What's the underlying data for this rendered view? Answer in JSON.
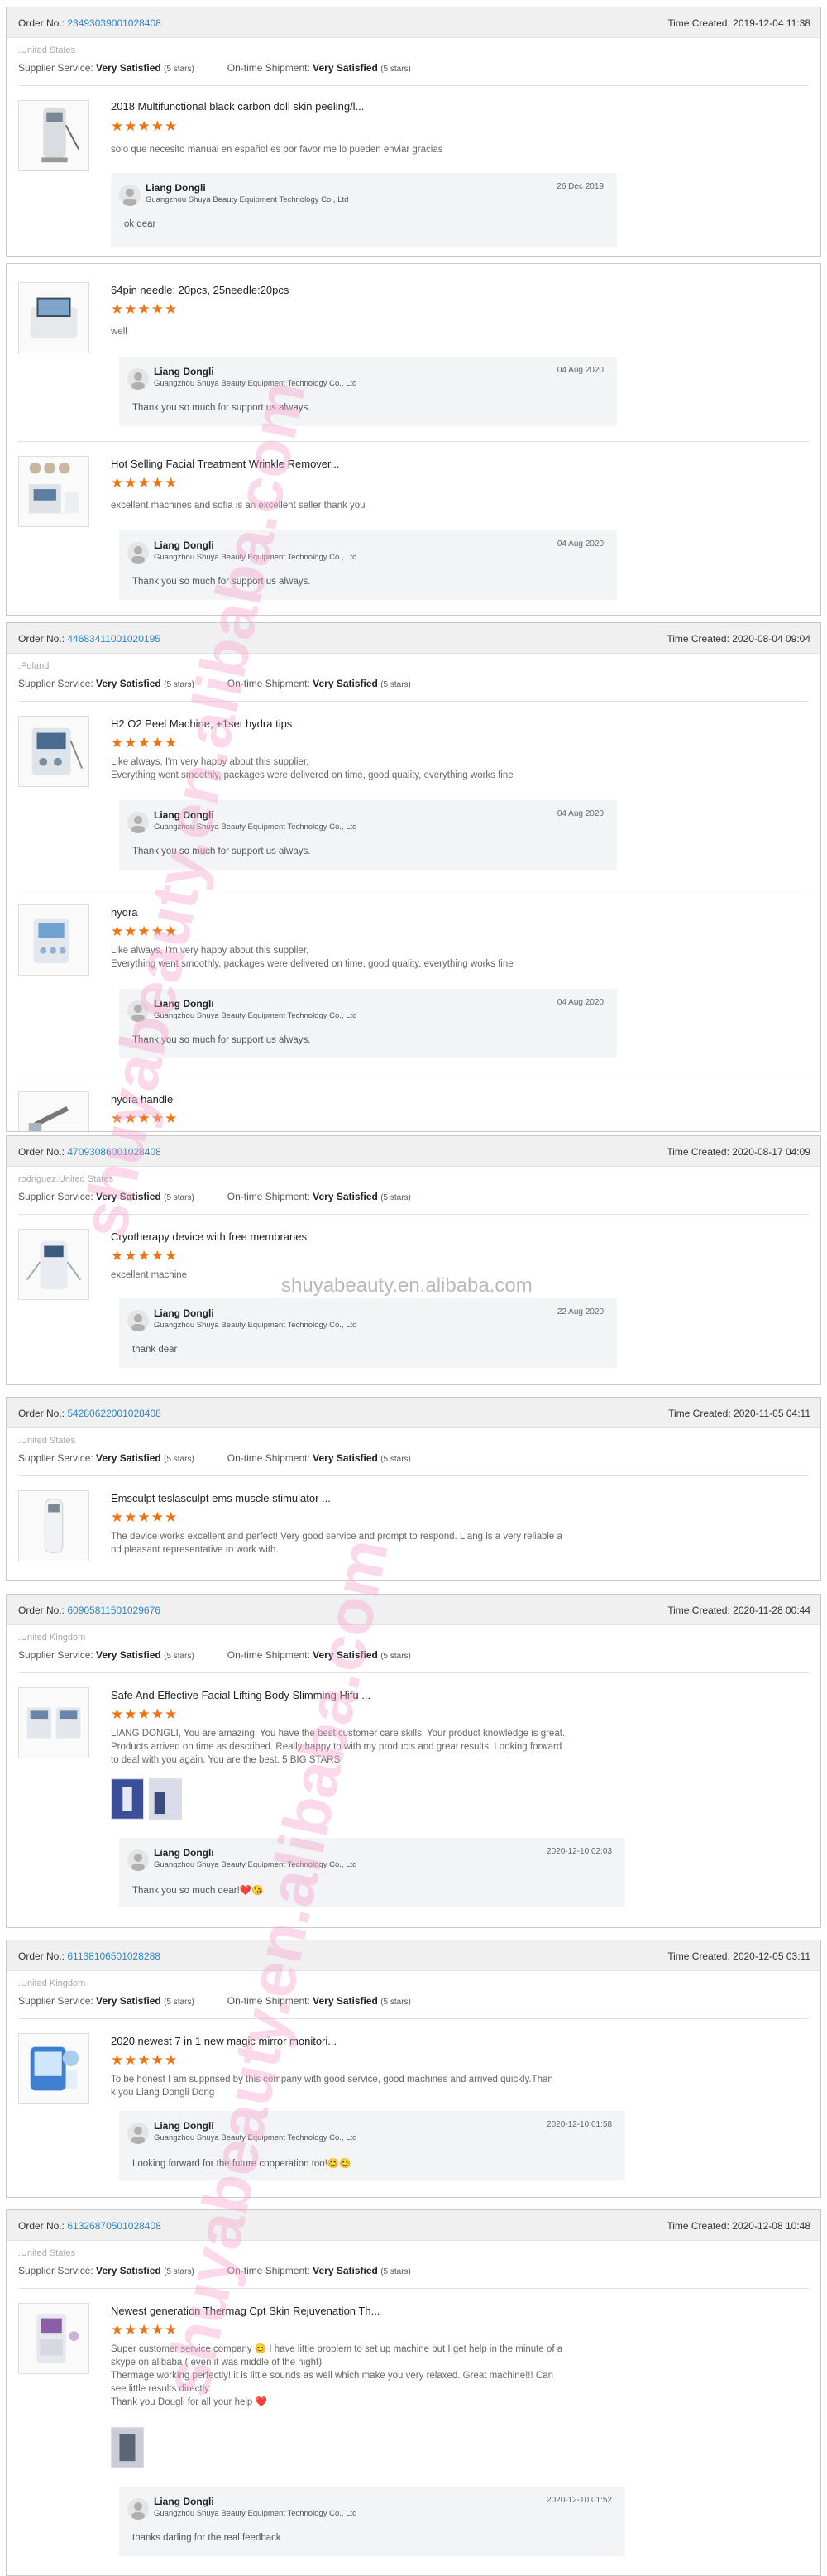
{
  "labels": {
    "order_no": "Order No.: ",
    "time_created": "Time Created: ",
    "supplier_service": "Supplier Service: ",
    "ontime_shipment": "On-time Shipment: ",
    "satisfied": "Very Satisfied",
    "five_stars": "(5 stars)",
    "replier": "Liang Dongli",
    "company": "Guangzhou Shuya Beauty Equipment Technology Co., Ltd"
  },
  "stars": "★★★★★",
  "watermark": "shuyabeauty.en.alibaba.com",
  "site_text": "shuyabeauty.en.alibaba.com",
  "orders": [
    {
      "order_no": "23493039001028408",
      "time": "2019-12-04 11:38",
      "buyer": ".United States",
      "items": [
        {
          "title": "2018 Multifunctional black carbon doll skin peeling/l...",
          "review": "solo que necesito manual en español es por favor me lo pueden enviar gracias",
          "reply_date": "26 Dec 2019",
          "reply": "ok dear"
        }
      ]
    },
    {
      "items": [
        {
          "title": "64pin needle: 20pcs, 25needle:20pcs",
          "review": "well",
          "reply_date": "04 Aug 2020",
          "reply": "Thank you so much for support us always."
        },
        {
          "title": "Hot Selling Facial Treatment Wrinkle Remover...",
          "review": "excellent machines and sofia is an excellent seller thank you",
          "reply_date": "04 Aug 2020",
          "reply": "Thank you so much for support us always."
        }
      ]
    },
    {
      "order_no": "44683411001020195",
      "time": "2020-08-04 09:04",
      "buyer": ".Poland",
      "items": [
        {
          "title": "H2 O2 Peel Machine, +1set hydra tips",
          "review": "Like always, I'm very happy about this supplier,\nEverything went smoothly, packages were delivered on time, good quality, everything works fine",
          "reply_date": "04 Aug 2020",
          "reply": "Thank you so much for support us always."
        },
        {
          "title": "hydra",
          "review": "Like always, I'm very happy about this supplier,\nEverything went smoothly, packages were delivered on time, good quality, everything works fine",
          "reply_date": "04 Aug 2020",
          "reply": "Thank you so much for support us always."
        },
        {
          "title": "hydra handle"
        }
      ]
    },
    {
      "order_no": "47093086001028408",
      "time": "2020-08-17 04:09",
      "buyer": "rodriguez.United States",
      "items": [
        {
          "title": "Cryotherapy device with free membranes",
          "review": "excellent machine",
          "reply_date": "22 Aug 2020",
          "reply": "thank dear"
        }
      ]
    },
    {
      "order_no": "54280622001028408",
      "time": "2020-11-05 04:11",
      "buyer": ".United States",
      "items": [
        {
          "title": "Emsculpt teslasculpt ems muscle stimulator ...",
          "review": "The device works excellent and perfect! Very good service and prompt to respond. Liang is a very reliable a\nnd pleasant representative to work with."
        }
      ]
    },
    {
      "order_no": "60905811501029676",
      "time": "2020-11-28 00:44",
      "buyer": ".United Kingdom",
      "items": [
        {
          "title": "Safe And Effective Facial Lifting Body Slimming Hifu ...",
          "review": "LIANG DONGLI, You are amazing. You have the best customer care skills. Your product knowledge is great.\nProducts arrived on time as described. Really happy to with my products and great results. Looking forward\nto deal with you again. You are the best. 5 BIG STARS",
          "reply_date": "2020-12-10 02:03",
          "reply": "Thank you so much dear!❤️😘"
        }
      ]
    },
    {
      "order_no": "61138106501028288",
      "time": "2020-12-05 03:11",
      "buyer": ".United Kingdom",
      "items": [
        {
          "title": "2020 newest 7 in 1 new magic mirror monitori...",
          "review": "To be honest I am supprised by this company with good service, good machines and arrived quickly.Than\nk you Liang Dongli Dong",
          "reply_date": "2020-12-10 01:58",
          "reply": "Looking forward for the future cooperation too!😊😊"
        }
      ]
    },
    {
      "order_no": "61326870501028408",
      "time": "2020-12-08 10:48",
      "buyer": ".United States",
      "items": [
        {
          "title": "Newest generation Thermag Cpt Skin Rejuvenation Th...",
          "review": "Super customer service company 😊 I have little problem to set up machine but I get help in the minute of a\nskype on alibaba ( even it was middle of the night)\nThermage working perfectly!  it is little sounds as well which make you very relaxed.   Great machine!!!  Can\nsee little results directly.\nThank you Dougli for all your help ❤️",
          "reply_date": "2020-12-10 01:52",
          "reply": "thanks darling for the real feedback"
        }
      ]
    }
  ]
}
